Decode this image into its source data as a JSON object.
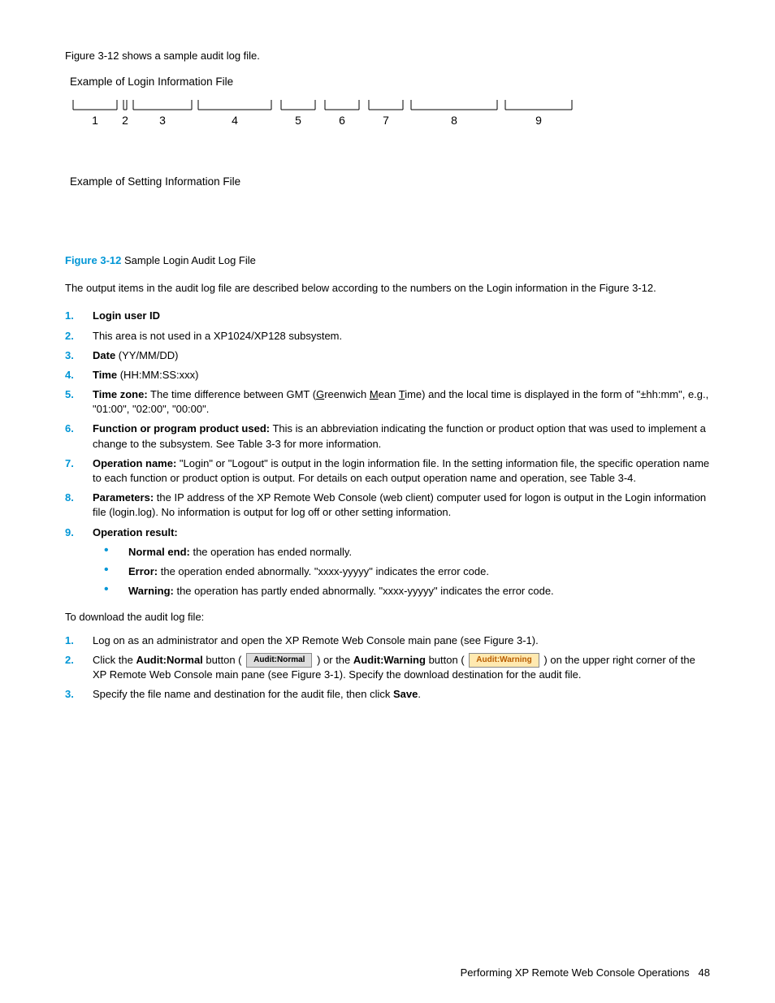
{
  "intro": "Figure 3-12 shows a sample audit log file.",
  "example1_title": "Example of Login Information File",
  "example2_title": "Example of Setting Information File",
  "figure_numbers": [
    "1",
    "2",
    "3",
    "4",
    "5",
    "6",
    "7",
    "8",
    "9"
  ],
  "fig_label": "Figure 3-12",
  "fig_caption": " Sample Login Audit Log File",
  "desc": "The output items in the audit log file are described below according to the numbers on the Login information in the Figure 3-12.",
  "items": [
    {
      "num": "1.",
      "title": "Login user ID",
      "text": ""
    },
    {
      "num": "2.",
      "title": "",
      "text": "This area is not used in a XP1024/XP128 subsystem."
    },
    {
      "num": "3.",
      "title": "Date",
      "text": " (YY/MM/DD)"
    },
    {
      "num": "4.",
      "title": "Time",
      "text": " (HH:MM:SS:xxx)"
    },
    {
      "num": "5.",
      "title": "Time zone:",
      "text_pre": " The time difference between GMT (",
      "g": "G",
      "m": "M",
      "t": "T",
      "text_mid1": "reenwich ",
      "text_mid2": "ean ",
      "text_mid3": "ime) and the local time is displayed in the form of \"±hh:mm\", e.g., \"01:00\", \"02:00\", \"00:00\"."
    },
    {
      "num": "6.",
      "title": "Function or program product used:",
      "text": " This is an abbreviation indicating the function or product option that was used to implement a change to the subsystem. See Table 3-3 for more information."
    },
    {
      "num": "7.",
      "title": "Operation name:",
      "text": " \"Login\" or \"Logout\" is output in the login information file. In the setting information file, the specific operation name to each function or product option is output. For details on each output operation name and operation, see Table 3-4."
    },
    {
      "num": "8.",
      "title": "Parameters:",
      "text": " the IP address of the XP Remote Web Console (web client) computer used for logon is output in the Login information file (login.log). No information is output for log off or other setting information."
    },
    {
      "num": "9.",
      "title": "Operation result:",
      "text": ""
    }
  ],
  "sub9": [
    {
      "title": "Normal end:",
      "text": " the operation has ended normally."
    },
    {
      "title": "Error:",
      "text": " the operation ended abnormally. \"xxxx-yyyyy\" indicates the error code."
    },
    {
      "title": "Warning:",
      "text": " the operation has partly ended abnormally. \"xxxx-yyyyy\" indicates the error code."
    }
  ],
  "download_intro": "To download the audit log file:",
  "steps": [
    {
      "num": "1.",
      "text": "Log on as an administrator and open the XP Remote Web Console main pane (see Figure 3-1)."
    },
    {
      "num": "2.",
      "t1": "Click the ",
      "b1": "Audit:Normal",
      "t2": " button ( ",
      "btn1": "Audit:Normal",
      "t3": " ) or the ",
      "b2": "Audit:Warning",
      "t4": " button ( ",
      "btn2": "Audit:Warning",
      "t5": " ) on the upper right corner of the XP Remote Web Console main pane (see Figure 3-1). Specify the download destination for the audit file."
    },
    {
      "num": "3.",
      "t1": "Specify the file name and destination for the audit file, then click ",
      "b1": "Save",
      "t2": "."
    }
  ],
  "footer_text": "Performing XP Remote Web Console Operations",
  "footer_page": "48"
}
